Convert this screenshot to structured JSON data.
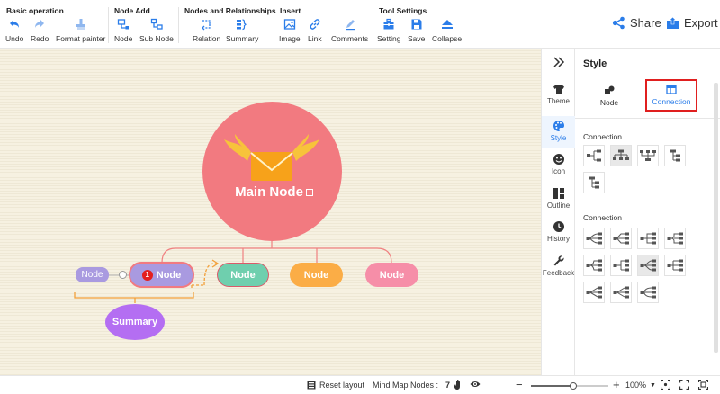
{
  "toolbar": {
    "groups": [
      {
        "title": "Basic operation",
        "buttons": [
          {
            "label": "Undo",
            "icon": "undo-icon"
          },
          {
            "label": "Redo",
            "icon": "redo-icon"
          },
          {
            "label": "Format painter",
            "icon": "brush-icon"
          }
        ]
      },
      {
        "title": "Node Add",
        "buttons": [
          {
            "label": "Node",
            "icon": "node-add-icon"
          },
          {
            "label": "Sub Node",
            "icon": "subnode-icon"
          }
        ]
      },
      {
        "title": "Nodes and Relationships",
        "buttons": [
          {
            "label": "Relation",
            "icon": "relation-icon"
          },
          {
            "label": "Summary",
            "icon": "summary-icon"
          }
        ]
      },
      {
        "title": "Insert",
        "buttons": [
          {
            "label": "Image",
            "icon": "image-icon"
          },
          {
            "label": "Link",
            "icon": "link-icon"
          },
          {
            "label": "Comments",
            "icon": "comment-icon"
          }
        ]
      },
      {
        "title": "Tool Settings",
        "buttons": [
          {
            "label": "Setting",
            "icon": "toolbox-icon"
          },
          {
            "label": "Save",
            "icon": "save-icon"
          },
          {
            "label": "Collapse",
            "icon": "collapse-icon"
          }
        ]
      }
    ],
    "share_label": "Share",
    "export_label": "Export"
  },
  "canvas": {
    "main_node": "Main Node",
    "children": [
      "Node",
      "Node",
      "Node",
      "Node"
    ],
    "side_node": "Node",
    "badge": "1",
    "summary": "Summary",
    "colors": {
      "main": "#f27a80",
      "purple": "#a99ae0",
      "green": "#6fcfae",
      "orange": "#fbad46",
      "pink": "#f68ea8",
      "summary": "#b46ef2"
    }
  },
  "sidebar": {
    "items": [
      {
        "label": "Theme",
        "icon": "shirt-icon"
      },
      {
        "label": "Style",
        "icon": "palette-icon"
      },
      {
        "label": "Icon",
        "icon": "smiley-icon"
      },
      {
        "label": "Outline",
        "icon": "outline-icon"
      },
      {
        "label": "History",
        "icon": "clock-icon"
      },
      {
        "label": "Feedback",
        "icon": "wrench-icon"
      }
    ]
  },
  "panel": {
    "title": "Style",
    "tabs": [
      {
        "label": "Node",
        "icon": "node-style-icon"
      },
      {
        "label": "Connection",
        "icon": "connection-style-icon"
      }
    ],
    "section1_label": "Connection",
    "section2_label": "Connection"
  },
  "status": {
    "reset_layout": "Reset layout",
    "nodes_label": "Mind Map Nodes :",
    "nodes_count": "7",
    "zoom": "100%",
    "zoom_fraction": 0.55
  }
}
